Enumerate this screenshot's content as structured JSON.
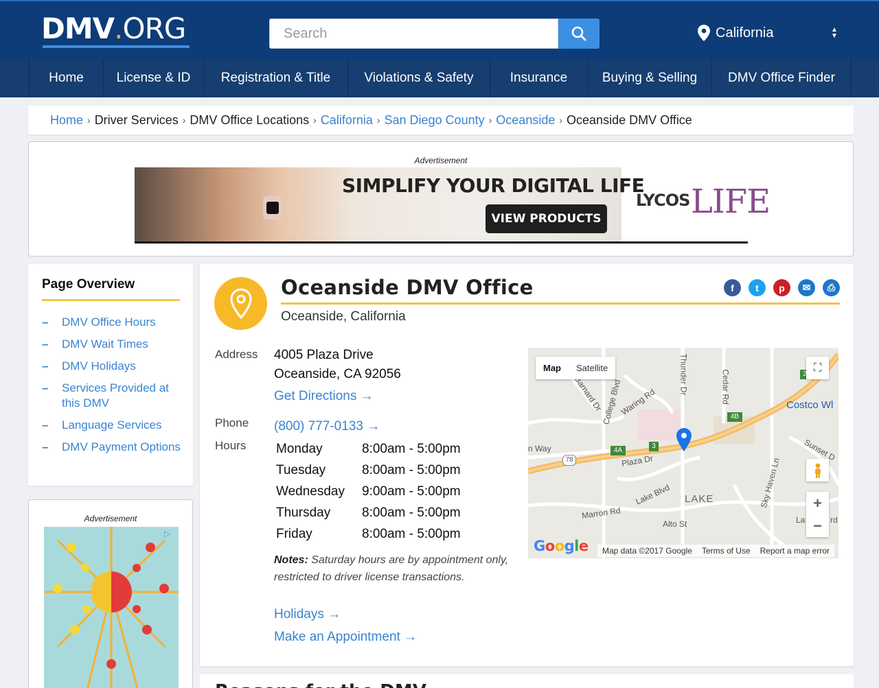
{
  "header": {
    "logo_main": "DMV",
    "logo_dot": ".",
    "logo_suffix": "ORG",
    "search_placeholder": "Search",
    "state": "California"
  },
  "nav": [
    "Home",
    "License & ID",
    "Registration & Title",
    "Violations & Safety",
    "Insurance",
    "Buying & Selling",
    "DMV Office Finder"
  ],
  "breadcrumb": [
    {
      "label": "Home",
      "link": true
    },
    {
      "label": "Driver Services",
      "link": false
    },
    {
      "label": "DMV Office Locations",
      "link": false
    },
    {
      "label": "California",
      "link": true
    },
    {
      "label": "San Diego County",
      "link": true
    },
    {
      "label": "Oceanside",
      "link": true
    },
    {
      "label": "Oceanside DMV Office",
      "link": false
    }
  ],
  "ad_top": {
    "label": "Advertisement",
    "headline": "SIMPLIFY YOUR DIGITAL LIFE",
    "cta": "VIEW PRODUCTS",
    "brand": "LYCOS",
    "brand2": "LIFE"
  },
  "overview": {
    "title": "Page Overview",
    "items": [
      "DMV Office Hours",
      "DMV Wait Times",
      "DMV Holidays",
      "Services Provided at this DMV",
      "Language Services",
      "DMV Payment Options"
    ]
  },
  "ad_side": {
    "label": "Advertisement"
  },
  "office": {
    "title": "Oceanside DMV Office",
    "subtitle": "Oceanside, California",
    "address_label": "Address",
    "address_line1": "4005 Plaza Drive",
    "address_line2": "Oceanside, CA 92056",
    "directions": "Get Directions →",
    "phone_label": "Phone",
    "phone": "(800) 777-0133 →",
    "hours_label": "Hours",
    "hours": [
      {
        "day": "Monday",
        "time": "8:00am - 5:00pm"
      },
      {
        "day": "Tuesday",
        "time": "8:00am - 5:00pm"
      },
      {
        "day": "Wednesday",
        "time": "9:00am - 5:00pm"
      },
      {
        "day": "Thursday",
        "time": "8:00am - 5:00pm"
      },
      {
        "day": "Friday",
        "time": "8:00am - 5:00pm"
      }
    ],
    "notes_label": "Notes:",
    "notes_text": "Saturday hours are by appointment only, restricted to driver license transactions.",
    "holidays_link": "Holidays →",
    "appointment_link": "Make an Appointment →"
  },
  "map": {
    "tab_map": "Map",
    "tab_satellite": "Satellite",
    "labels": [
      "Plaza Dr",
      "Lake Blvd",
      "LAKE",
      "Alto St",
      "Marron Rd",
      "Costco Wl",
      "Sunset D",
      "Cedar Rd",
      "Thunder Dr",
      "College Blvd",
      "Barnard Dr",
      "Waring Rd",
      "Sky Haven Ln",
      "n Way",
      "La",
      "rd"
    ],
    "shields": [
      "78",
      "4A",
      "3",
      "4B",
      "2"
    ],
    "google": "Google",
    "footer": [
      "Map data ©2017 Google",
      "Terms of Use",
      "Report a map error"
    ]
  },
  "next_section_peek": "Reasons for the DMV",
  "colors": {
    "header": "#0d3c78",
    "nav": "#163e70",
    "accent": "#f6c343",
    "link": "#3b82d1",
    "search_button": "#3b8fe3"
  }
}
